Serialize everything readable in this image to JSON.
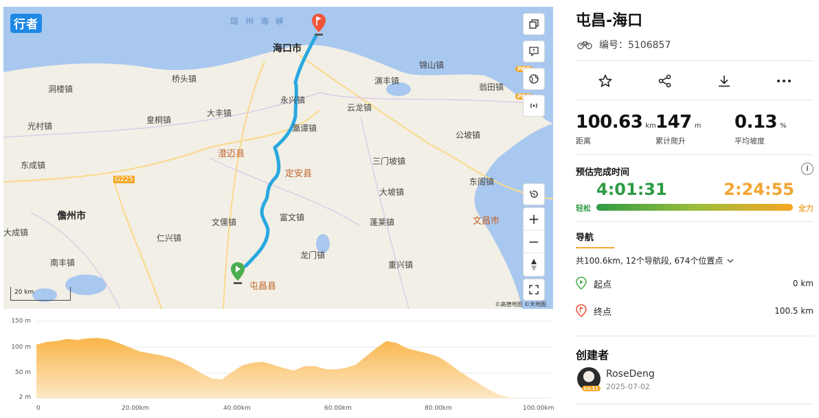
{
  "map": {
    "logo": "行者",
    "strait": "琼州海峡",
    "scale_label": "20 km",
    "copyright": "©高德地图  ©天地图",
    "pro_badge": "PRO",
    "places": {
      "haikou": "海口市",
      "chengmai": "澄迈县",
      "dingan": "定安县",
      "tunchang": "屯昌县",
      "danzhou": "儋州市",
      "wenchang": "文昌市",
      "qiaotou": "桥头镇",
      "jinshan": "锦山镇",
      "yanfeng": "演丰镇",
      "wengtian": "翁田镇",
      "dongying": "洞楼镇",
      "yongxing": "永兴镇",
      "yunlong": "云龙镇",
      "dafeng": "大丰镇",
      "guangcun": "光村镇",
      "huangtong": "皇桐镇",
      "yanjiang": "瀛谭镇",
      "gongpo": "公坡镇",
      "dongcheng": "东成镇",
      "sanmenpo": "三门坡镇",
      "donggao": "东阁镇",
      "dapo": "大坡镇",
      "g225": "G225",
      "wenru": "文儒镇",
      "fuwen": "富文镇",
      "penglai": "蓬莱镇",
      "dacheng": "大成镇",
      "renxing": "仁兴镇",
      "longmen": "龙门镇",
      "nanfeng": "南丰镇",
      "chongxing": "重兴镇"
    }
  },
  "elevation": {
    "y_ticks": [
      "150 m",
      "100 m",
      "50 m",
      "2 m"
    ],
    "x_ticks": [
      "0",
      "20.00km",
      "40.00km",
      "60.00km",
      "80.00km",
      "100.00km"
    ],
    "profile_km": [
      0,
      2,
      4,
      6,
      8,
      10,
      12,
      14,
      16,
      18,
      20,
      22,
      24,
      26,
      28,
      30,
      32,
      34,
      36,
      38,
      40,
      42,
      44,
      46,
      48,
      50,
      52,
      54,
      56,
      58,
      60,
      62,
      64,
      66,
      68,
      70,
      72,
      74,
      76,
      78,
      80,
      82,
      84,
      86,
      88,
      90,
      92,
      100.63
    ],
    "profile_m": [
      105,
      110,
      112,
      116,
      114,
      117,
      118,
      115,
      108,
      100,
      92,
      88,
      85,
      80,
      72,
      62,
      50,
      40,
      38,
      52,
      65,
      70,
      72,
      66,
      60,
      55,
      63,
      64,
      58,
      57,
      60,
      66,
      82,
      98,
      112,
      108,
      98,
      93,
      88,
      82,
      70,
      55,
      42,
      30,
      18,
      8,
      3,
      2
    ]
  },
  "route": {
    "title": "屯昌-海口",
    "code_label": "编号：5106857"
  },
  "stats": [
    {
      "value": "100.63",
      "unit": "km",
      "label": "距离"
    },
    {
      "value": "147",
      "unit": "m",
      "label": "累计爬升"
    },
    {
      "value": "0.13",
      "unit": "%",
      "label": "平均坡度"
    }
  ],
  "eta": {
    "title": "预估完成时间",
    "easy_time": "4:01:31",
    "full_time": "2:24:55",
    "easy_label": "轻松",
    "full_label": "全力",
    "info": "i"
  },
  "navigation": {
    "title": "导航",
    "summary": "共100.6km, 12个导航段, 674个位置点",
    "start_label": "起点",
    "start_dist": "0 km",
    "end_label": "终点",
    "end_dist": "100.5 km"
  },
  "creator": {
    "title": "创建者",
    "name": "RoseDeng",
    "date": "2025-07-02",
    "level": "Lv.11"
  },
  "colors": {
    "route": "#29a8e0",
    "start_marker": "#4caf50",
    "end_marker": "#f0553a",
    "elevation_fill": "#f9b54a"
  }
}
